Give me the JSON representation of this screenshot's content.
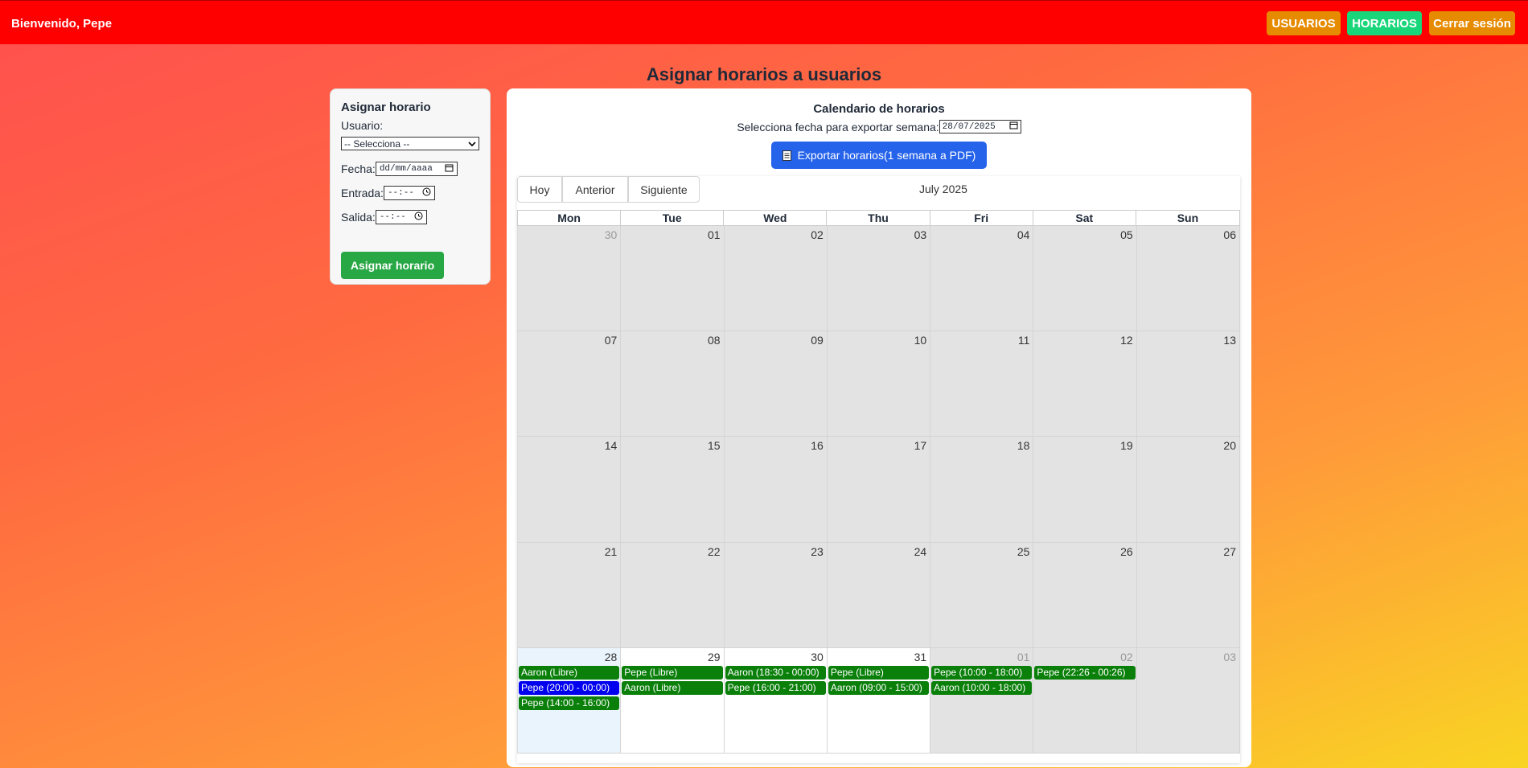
{
  "header": {
    "welcome": "Bienvenido, Pepe",
    "nav": {
      "usuarios": "USUARIOS",
      "horarios": "HORARIOS",
      "logout": "Cerrar sesión"
    }
  },
  "page_title": "Asignar horarios a usuarios",
  "form": {
    "title": "Asignar horario",
    "usuario_label": "Usuario:",
    "usuario_value": "-- Selecciona --",
    "fecha_label": "Fecha:",
    "fecha_placeholder": "dd/mm/aaaa",
    "entrada_label": "Entrada:",
    "salida_label": "Salida:",
    "time_placeholder": "--:--",
    "submit": "Asignar horario"
  },
  "calendar_panel": {
    "title": "Calendario de horarios",
    "export_label": "Selecciona fecha para exportar semana:",
    "export_date": "28/07/2025",
    "export_button": "Exportar horarios(1 semana a PDF)",
    "toolbar": {
      "today": "Hoy",
      "prev": "Anterior",
      "next": "Siguiente"
    },
    "month_title": "July 2025",
    "weekdays": [
      "Mon",
      "Tue",
      "Wed",
      "Thu",
      "Fri",
      "Sat",
      "Sun"
    ],
    "weeks": [
      [
        {
          "day": "30",
          "dim": true
        },
        {
          "day": "01"
        },
        {
          "day": "02"
        },
        {
          "day": "03"
        },
        {
          "day": "04"
        },
        {
          "day": "05"
        },
        {
          "day": "06"
        }
      ],
      [
        {
          "day": "07"
        },
        {
          "day": "08"
        },
        {
          "day": "09"
        },
        {
          "day": "10"
        },
        {
          "day": "11"
        },
        {
          "day": "12"
        },
        {
          "day": "13"
        }
      ],
      [
        {
          "day": "14"
        },
        {
          "day": "15"
        },
        {
          "day": "16"
        },
        {
          "day": "17"
        },
        {
          "day": "18"
        },
        {
          "day": "19"
        },
        {
          "day": "20"
        }
      ],
      [
        {
          "day": "21"
        },
        {
          "day": "22"
        },
        {
          "day": "23"
        },
        {
          "day": "24"
        },
        {
          "day": "25"
        },
        {
          "day": "26"
        },
        {
          "day": "27"
        }
      ],
      [
        {
          "day": "28",
          "today": true,
          "events": [
            {
              "text": "Aaron (Libre)"
            },
            {
              "text": "Pepe (20:00 - 00:00)",
              "blue": true
            },
            {
              "text": "Pepe (14:00 - 16:00)"
            }
          ]
        },
        {
          "day": "29",
          "white": true,
          "events": [
            {
              "text": "Pepe (Libre)"
            },
            {
              "text": "Aaron (Libre)"
            }
          ]
        },
        {
          "day": "30",
          "white": true,
          "events": [
            {
              "text": "Aaron (18:30 - 00:00)"
            },
            {
              "text": "Pepe (16:00 - 21:00)"
            }
          ]
        },
        {
          "day": "31",
          "white": true,
          "events": [
            {
              "text": "Pepe (Libre)"
            },
            {
              "text": "Aaron (09:00 - 15:00)"
            }
          ]
        },
        {
          "day": "01",
          "dim": true,
          "events": [
            {
              "text": "Pepe (10:00 - 18:00)"
            },
            {
              "text": "Aaron (10:00 - 18:00)"
            }
          ]
        },
        {
          "day": "02",
          "dim": true,
          "events": [
            {
              "text": "Pepe (22:26 - 00:26)"
            }
          ]
        },
        {
          "day": "03",
          "dim": true,
          "events": []
        }
      ]
    ]
  },
  "colors": {
    "topbar": "#ff0000",
    "event_green": "#0a7f0a",
    "event_blue": "#0000ee",
    "export_button": "#2563eb"
  }
}
